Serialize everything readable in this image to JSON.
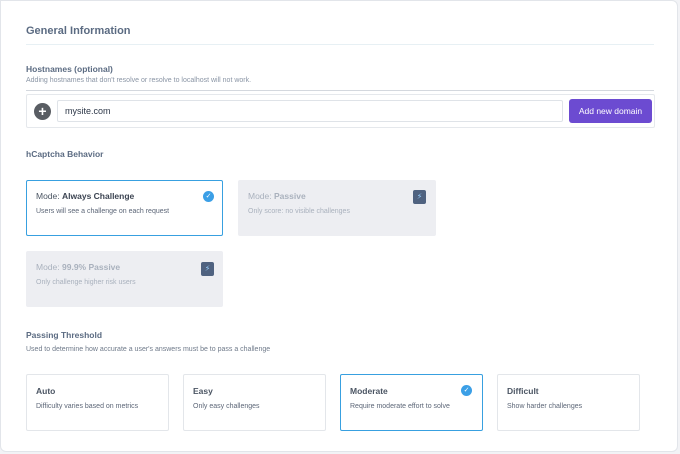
{
  "general": {
    "title": "General Information"
  },
  "hostnames": {
    "label": "Hostnames (optional)",
    "help": "Adding hostnames that don't resolve or resolve to localhost will not work.",
    "input_value": "mysite.com",
    "add_button": "Add new domain",
    "plus_glyph": "+"
  },
  "behavior": {
    "heading": "hCaptcha Behavior",
    "modes": [
      {
        "prefix": "Mode: ",
        "name": "Always Challenge",
        "description": "Users will see a challenge on each request",
        "state": "selected",
        "icon": "check-icon"
      },
      {
        "prefix": "Mode: ",
        "name": "Passive",
        "description": "Only score: no visible challenges",
        "state": "disabled",
        "icon": "bolt-icon"
      },
      {
        "prefix": "Mode: ",
        "name": "99.9% Passive",
        "description": "Only challenge higher risk users",
        "state": "disabled",
        "icon": "bolt-icon"
      }
    ]
  },
  "threshold": {
    "heading": "Passing Threshold",
    "help": "Used to determine how accurate a user's answers must be to pass a challenge",
    "options": [
      {
        "title": "Auto",
        "description": "Difficulty varies based on metrics",
        "selected": false
      },
      {
        "title": "Easy",
        "description": "Only easy challenges",
        "selected": false
      },
      {
        "title": "Moderate",
        "description": "Require moderate effort to solve",
        "selected": true
      },
      {
        "title": "Difficult",
        "description": "Show harder challenges",
        "selected": false
      }
    ]
  },
  "icons": {
    "check": "✓",
    "bolt": "⚡"
  },
  "colors": {
    "accent_button": "#6c4bd1",
    "selected_border": "#38a0e0",
    "check_bg": "#3b9fe6",
    "disabled_bg": "#edeef2",
    "bolt_bg": "#4f6280"
  }
}
